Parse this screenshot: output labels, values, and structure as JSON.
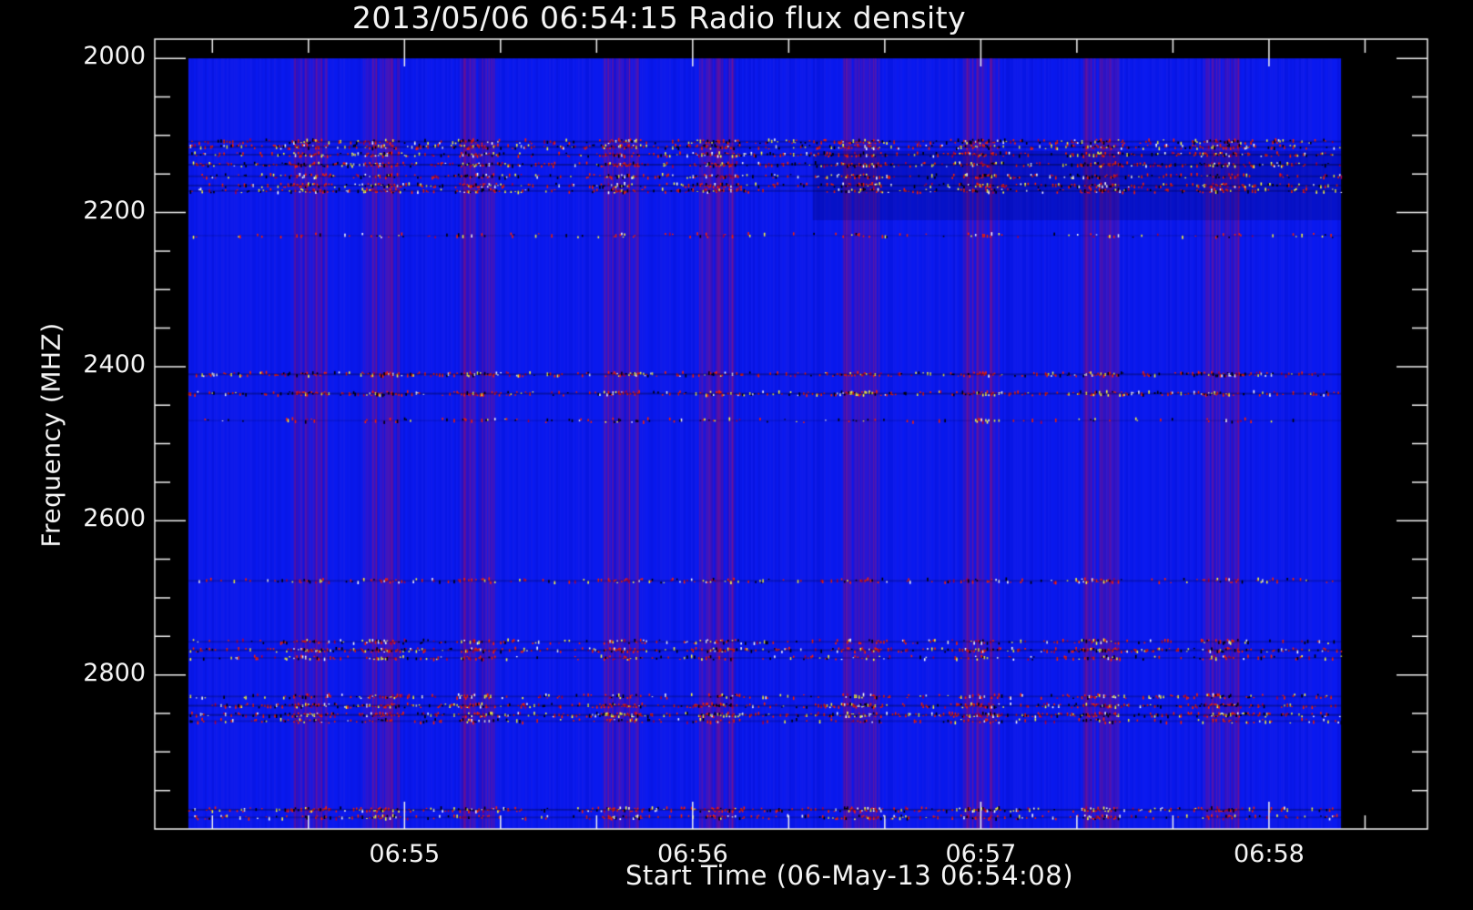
{
  "chart_data": {
    "type": "heatmap",
    "title": "2013/05/06 06:54:15 Radio flux density",
    "xlabel": "Start Time (06-May-13 06:54:08)",
    "ylabel": "Frequency (MHZ)",
    "y_axis": {
      "range": [
        1975,
        3000
      ],
      "inverted": true,
      "data_extent": [
        2000,
        3000
      ],
      "major_ticks": [
        2000,
        2200,
        2400,
        2600,
        2800
      ],
      "tick_labels": [
        "2000",
        "2200",
        "2400",
        "2600",
        "2800"
      ],
      "minor_tick_step": 50
    },
    "x_axis": {
      "range": [
        "06:54:08",
        "06:58:33"
      ],
      "data_extent": [
        "06:54:15",
        "06:58:15"
      ],
      "major_ticks": [
        "06:55",
        "06:56",
        "06:57",
        "06:58"
      ],
      "tick_labels": [
        "06:55",
        "06:56",
        "06:57",
        "06:58"
      ],
      "minor_tick_step_seconds": 20
    },
    "colormap": [
      "#000000",
      "#0000ff",
      "#ff0000",
      "#ffff00",
      "#ffffff"
    ],
    "background_color": "#0a1af0",
    "interference_bands_mhz": [
      {
        "freq": 2108,
        "intensity": 0.75
      },
      {
        "freq": 2115,
        "intensity": 0.85
      },
      {
        "freq": 2125,
        "intensity": 0.8
      },
      {
        "freq": 2138,
        "intensity": 0.95
      },
      {
        "freq": 2153,
        "intensity": 0.7
      },
      {
        "freq": 2165,
        "intensity": 0.8
      },
      {
        "freq": 2172,
        "intensity": 0.7
      },
      {
        "freq": 2230,
        "intensity": 0.3
      },
      {
        "freq": 2410,
        "intensity": 0.85
      },
      {
        "freq": 2435,
        "intensity": 0.85
      },
      {
        "freq": 2470,
        "intensity": 0.3
      },
      {
        "freq": 2678,
        "intensity": 0.6
      },
      {
        "freq": 2757,
        "intensity": 0.6
      },
      {
        "freq": 2768,
        "intensity": 0.85
      },
      {
        "freq": 2778,
        "intensity": 0.5
      },
      {
        "freq": 2828,
        "intensity": 0.6
      },
      {
        "freq": 2840,
        "intensity": 0.9
      },
      {
        "freq": 2852,
        "intensity": 0.95
      },
      {
        "freq": 2860,
        "intensity": 0.5
      },
      {
        "freq": 2975,
        "intensity": 0.85
      },
      {
        "freq": 2985,
        "intensity": 0.6
      }
    ],
    "burst_times": [
      "06:54:40",
      "06:54:55",
      "06:55:15",
      "06:55:45",
      "06:56:05",
      "06:56:35",
      "06:57:00",
      "06:57:25",
      "06:57:50"
    ],
    "grid": false
  }
}
